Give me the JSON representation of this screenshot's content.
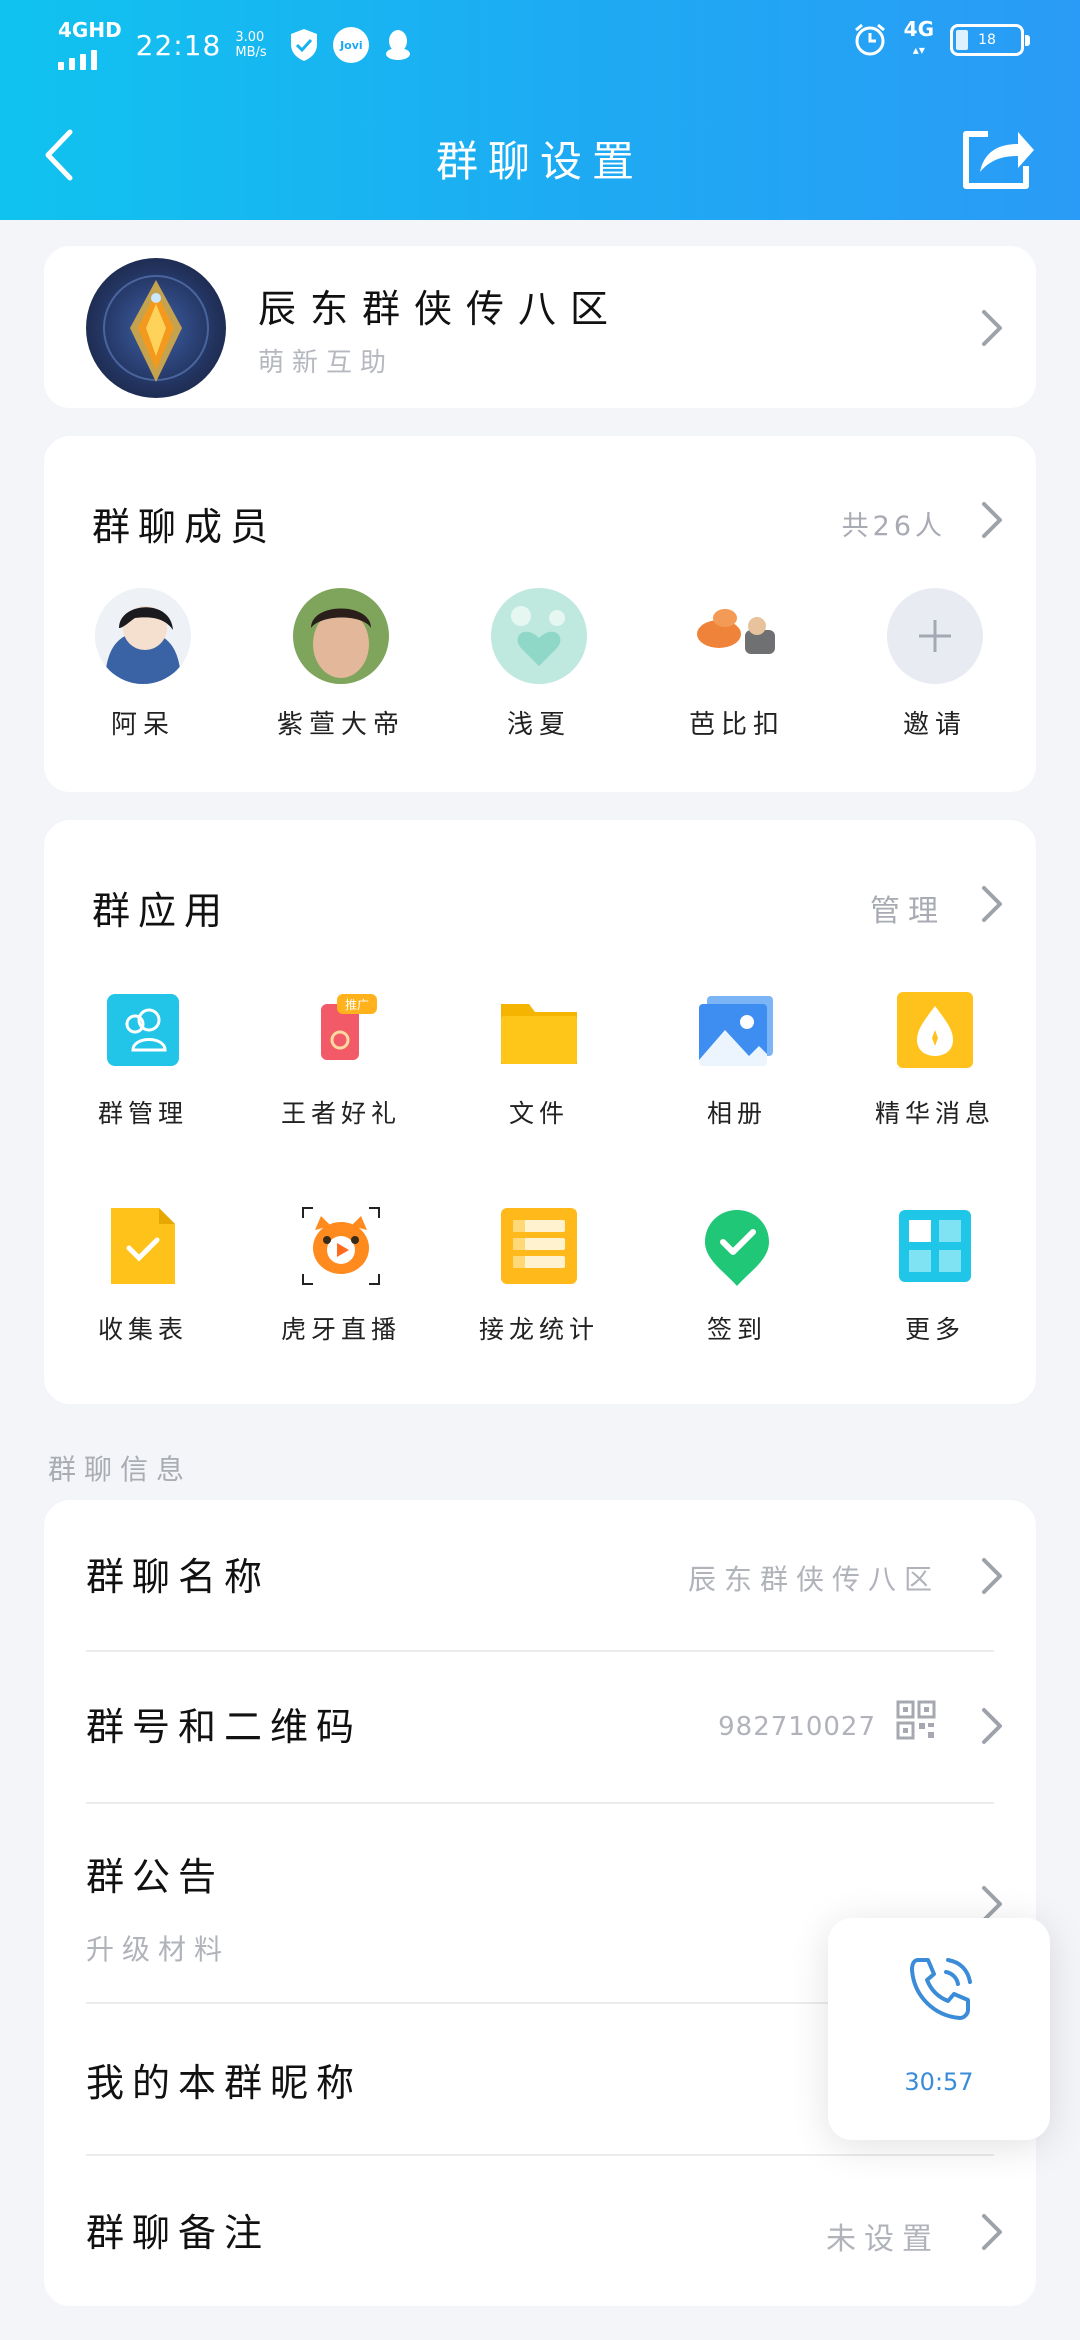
{
  "status_bar": {
    "network": "4GHD",
    "time": "22:18",
    "speed_value": "3.00",
    "speed_unit": "MB/s",
    "jovi": "Jovi",
    "right_network": "4G",
    "battery": "18"
  },
  "header": {
    "title": "群聊设置"
  },
  "group": {
    "name": "辰东群侠传八区",
    "subtitle": "萌新互助"
  },
  "members": {
    "title": "群聊成员",
    "count": "共26人",
    "items": [
      {
        "name": "阿呆"
      },
      {
        "name": "紫萱大帝"
      },
      {
        "name": "浅夏"
      },
      {
        "name": "芭比扣"
      },
      {
        "name": "邀请"
      }
    ]
  },
  "apps": {
    "title": "群应用",
    "manage": "管理",
    "promo_badge": "推广",
    "items": [
      {
        "name": "群管理",
        "icon": "group-manage-icon"
      },
      {
        "name": "王者好礼",
        "icon": "gift-icon"
      },
      {
        "name": "文件",
        "icon": "folder-icon"
      },
      {
        "name": "相册",
        "icon": "album-icon"
      },
      {
        "name": "精华消息",
        "icon": "essence-icon"
      },
      {
        "name": "收集表",
        "icon": "form-icon"
      },
      {
        "name": "虎牙直播",
        "icon": "huya-icon"
      },
      {
        "name": "接龙统计",
        "icon": "chain-icon"
      },
      {
        "name": "签到",
        "icon": "checkin-icon"
      },
      {
        "name": "更多",
        "icon": "more-icon"
      }
    ]
  },
  "info": {
    "section_label": "群聊信息",
    "name_label": "群聊名称",
    "name_value": "辰东群侠传八区",
    "number_label": "群号和二维码",
    "number_value": "982710027",
    "notice_label": "群公告",
    "notice_value": "升级材料",
    "nickname_label": "我的本群昵称",
    "remark_label": "群聊备注",
    "remark_value": "未设置"
  },
  "call": {
    "duration": "30:57"
  }
}
